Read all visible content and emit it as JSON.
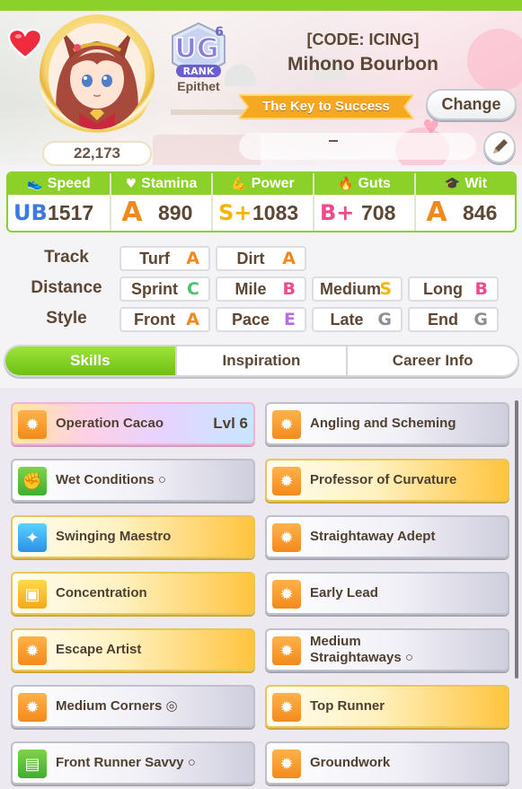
{
  "header": {
    "fans": "22,173",
    "rank": "UG",
    "rank_level": "6",
    "rank_caption": "RANK",
    "epithet_label": "Epithet",
    "code_title": "[CODE: ICING]",
    "name": "Mihono Bourbon",
    "epithet": "The Key to Success",
    "change_label": "Change",
    "edit_value": "-"
  },
  "stats": [
    {
      "name": "Speed",
      "icon": "shoe-icon",
      "grade": "UB",
      "value": "1517",
      "color": "#3d7ae0"
    },
    {
      "name": "Stamina",
      "icon": "heart-icon",
      "grade": "A",
      "value": "890",
      "color": "#f08a1e"
    },
    {
      "name": "Power",
      "icon": "arm-icon",
      "grade": "S+",
      "value": "1083",
      "color": "#f5b400"
    },
    {
      "name": "Guts",
      "icon": "flame-icon",
      "grade": "B+",
      "value": "708",
      "color": "#ee4a8c"
    },
    {
      "name": "Wit",
      "icon": "cap-icon",
      "grade": "A",
      "value": "846",
      "color": "#f08a1e"
    }
  ],
  "aptitude": {
    "track_label": "Track",
    "distance_label": "Distance",
    "style_label": "Style",
    "track": [
      {
        "name": "Turf",
        "grade": "A",
        "color": "#f08a1e"
      },
      {
        "name": "Dirt",
        "grade": "A",
        "color": "#f08a1e"
      }
    ],
    "distance": [
      {
        "name": "Sprint",
        "grade": "C",
        "color": "#4cc36b"
      },
      {
        "name": "Mile",
        "grade": "B",
        "color": "#ee4a8c"
      },
      {
        "name": "Medium",
        "grade": "S",
        "color": "#f5b400"
      },
      {
        "name": "Long",
        "grade": "B",
        "color": "#ee4a8c"
      }
    ],
    "style": [
      {
        "name": "Front",
        "grade": "A",
        "color": "#f08a1e"
      },
      {
        "name": "Pace",
        "grade": "E",
        "color": "#b96be0"
      },
      {
        "name": "Late",
        "grade": "G",
        "color": "#8f8f99"
      },
      {
        "name": "End",
        "grade": "G",
        "color": "#8f8f99"
      }
    ]
  },
  "tabs": [
    {
      "label": "Skills",
      "active": true
    },
    {
      "label": "Inspiration",
      "active": false
    },
    {
      "label": "Career Info",
      "active": false
    }
  ],
  "skills": [
    {
      "name": "Operation Cacao",
      "level": "Lvl 6",
      "style": "rainbow",
      "icon": "runner-icon",
      "icon_color": "orange"
    },
    {
      "name": "Angling and Scheming",
      "level": "",
      "style": "plain",
      "icon": "runner-icon",
      "icon_color": "orange"
    },
    {
      "name": "Wet Conditions ○",
      "level": "",
      "style": "plain",
      "icon": "muscle-icon",
      "icon_color": "green"
    },
    {
      "name": "Professor of Curvature",
      "level": "",
      "style": "gold",
      "icon": "runner-icon",
      "icon_color": "orange"
    },
    {
      "name": "Swinging Maestro",
      "level": "",
      "style": "gold",
      "icon": "sparkle-icon",
      "icon_color": "blue"
    },
    {
      "name": "Straightaway Adept",
      "level": "",
      "style": "plain",
      "icon": "runner-icon",
      "icon_color": "orange"
    },
    {
      "name": "Concentration",
      "level": "",
      "style": "gold",
      "icon": "gate-icon",
      "icon_color": "yellow"
    },
    {
      "name": "Early Lead",
      "level": "",
      "style": "plain",
      "icon": "runner-icon",
      "icon_color": "orange"
    },
    {
      "name": "Escape Artist",
      "level": "",
      "style": "gold",
      "icon": "runner-icon",
      "icon_color": "orange"
    },
    {
      "name": "Medium Straightaways ○",
      "level": "",
      "style": "plain",
      "icon": "runner-icon",
      "icon_color": "orange"
    },
    {
      "name": "Medium Corners ◎",
      "level": "",
      "style": "plain",
      "icon": "runner-icon",
      "icon_color": "orange"
    },
    {
      "name": "Top Runner",
      "level": "",
      "style": "gold",
      "icon": "runner-icon",
      "icon_color": "orange"
    },
    {
      "name": "Front Runner Savvy ○",
      "level": "",
      "style": "plain",
      "icon": "book-icon",
      "icon_color": "green"
    },
    {
      "name": "Groundwork",
      "level": "",
      "style": "plain",
      "icon": "runner-icon",
      "icon_color": "orange"
    }
  ]
}
